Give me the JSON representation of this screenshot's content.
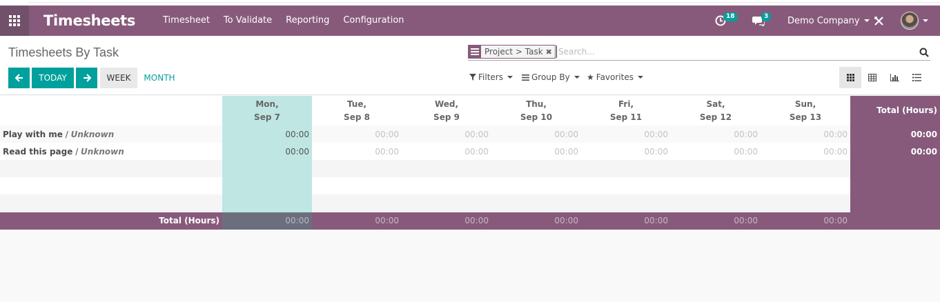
{
  "navbar": {
    "brand": "Timesheets",
    "menu": [
      "Timesheet",
      "To Validate",
      "Reporting",
      "Configuration"
    ],
    "activity_count": "18",
    "message_count": "3",
    "company": "Demo Company"
  },
  "control": {
    "title": "Timesheets By Task",
    "facet_label": "Project > Task",
    "search_placeholder": "Search...",
    "today_label": "TODAY",
    "week_label": "WEEK",
    "month_label": "MONTH",
    "filters_label": "Filters",
    "groupby_label": "Group By",
    "favorites_label": "Favorites"
  },
  "grid": {
    "days": [
      {
        "dow": "Mon,",
        "date": "Sep 7"
      },
      {
        "dow": "Tue,",
        "date": "Sep 8"
      },
      {
        "dow": "Wed,",
        "date": "Sep 9"
      },
      {
        "dow": "Thu,",
        "date": "Sep 10"
      },
      {
        "dow": "Fri,",
        "date": "Sep 11"
      },
      {
        "dow": "Sat,",
        "date": "Sep 12"
      },
      {
        "dow": "Sun,",
        "date": "Sep 13"
      }
    ],
    "total_header": "Total (Hours)",
    "rows": [
      {
        "project": "Play with me",
        "task": "Unknown",
        "values": [
          "00:00",
          "00:00",
          "00:00",
          "00:00",
          "00:00",
          "00:00",
          "00:00"
        ],
        "total": "00:00"
      },
      {
        "project": "Read this page",
        "task": "Unknown",
        "values": [
          "00:00",
          "00:00",
          "00:00",
          "00:00",
          "00:00",
          "00:00",
          "00:00"
        ],
        "total": "00:00"
      }
    ],
    "footer_label": "Total (Hours)",
    "footer_values": [
      "00:00",
      "00:00",
      "00:00",
      "00:00",
      "00:00",
      "00:00",
      "00:00"
    ]
  },
  "colors": {
    "brand_purple": "#875a7b",
    "teal": "#00a09d",
    "today_highlight": "#bfe6e3"
  }
}
